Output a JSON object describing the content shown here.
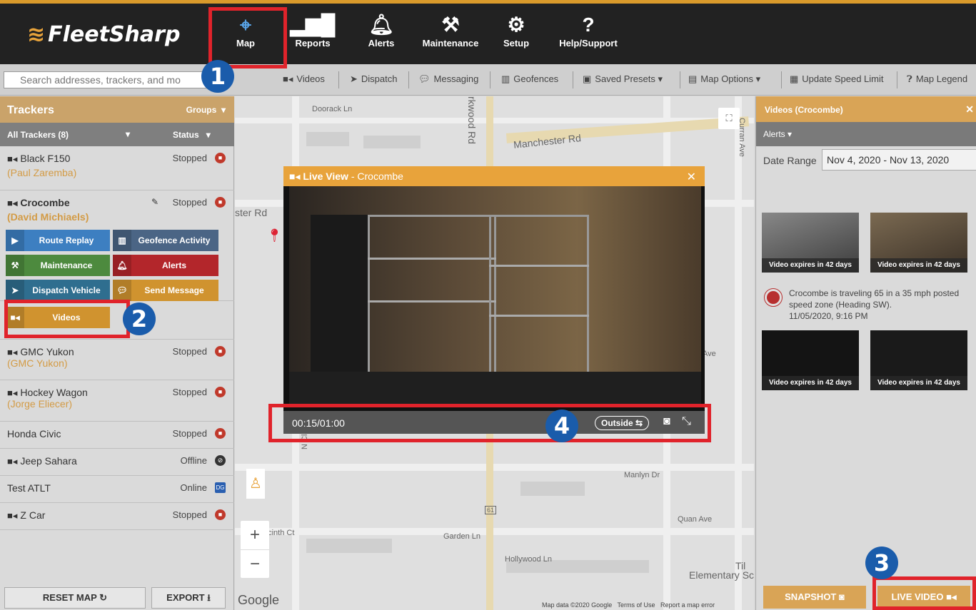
{
  "app": {
    "logo": "FleetSharp"
  },
  "nav": [
    {
      "label": "Map",
      "icon": "map-pin-icon"
    },
    {
      "label": "Reports",
      "icon": "bar-chart-icon"
    },
    {
      "label": "Alerts",
      "icon": "bell-icon"
    },
    {
      "label": "Maintenance",
      "icon": "wrench-car-icon"
    },
    {
      "label": "Setup",
      "icon": "gear-icon"
    },
    {
      "label": "Help/Support",
      "icon": "help-icon"
    }
  ],
  "toolbar": {
    "search_placeholder": "Search addresses, trackers, and mo",
    "videos": "Videos",
    "dispatch": "Dispatch",
    "messaging": "Messaging",
    "geofences": "Geofences",
    "saved_presets": "Saved Presets",
    "map_options": "Map Options",
    "update_speed_limit": "Update Speed Limit",
    "map_legend": "Map Legend"
  },
  "sidebar": {
    "title": "Trackers",
    "groups": "Groups",
    "all_trackers": "All Trackers (8)",
    "status": "Status",
    "trackers": [
      {
        "name": "Black F150",
        "driver": "(Paul Zaremba)",
        "status": "Stopped"
      },
      {
        "name": "Crocombe",
        "driver": "(David Michiaels)",
        "status": "Stopped"
      },
      {
        "name": "GMC Yukon",
        "driver": "(GMC Yukon)",
        "status": "Stopped"
      },
      {
        "name": "Hockey Wagon",
        "driver": "(Jorge Eliecer)",
        "status": "Stopped"
      },
      {
        "name": "Honda Civic",
        "driver": "",
        "status": "Stopped"
      },
      {
        "name": "Jeep Sahara",
        "driver": "",
        "status": "Offline"
      },
      {
        "name": "Test ATLT",
        "driver": "",
        "status": "Online"
      },
      {
        "name": "Z Car",
        "driver": "",
        "status": "Stopped"
      }
    ],
    "actions": {
      "route_replay": "Route Replay",
      "geofence_activity": "Geofence Activity",
      "maintenance": "Maintenance",
      "alerts": "Alerts",
      "dispatch_vehicle": "Dispatch Vehicle",
      "send_message": "Send Message",
      "videos": "Videos"
    },
    "reset_map": "RESET MAP",
    "export": "EXPORT",
    "online_badge": "DG"
  },
  "map": {
    "labels": [
      "Doorack Ln",
      "Manchester Rd",
      "rkwood Rd",
      "ster Rd",
      "N Clay Ave",
      "N Clay Ave",
      "Manlyn Dr",
      "Quan Ave",
      "acinth Ct",
      "Garden Ln",
      "Hollywood Ln",
      "Elementary Sc",
      "Curran Ave",
      "Curran Ave",
      "Curran Ave",
      "N Tay",
      "Ave",
      "Til",
      "61"
    ],
    "google": "Google",
    "footer": "Map data ©2020 Google   Terms of Use   Report a map error"
  },
  "live_view": {
    "title_bold": "Live View",
    "title_rest": " - Crocombe",
    "time": "00:15/01:00",
    "camera": "Outside"
  },
  "right_panel": {
    "title": "Videos (Crocombe)",
    "alerts": "Alerts",
    "date_range_label": "Date Range",
    "date_range_value": "Nov 4, 2020 - Nov 13, 2020",
    "expires": "Video expires in 42 days",
    "alert_message": "Crocombe is traveling 65 in a 35 mph posted speed zone (Heading SW).",
    "alert_time": "11/05/2020, 9:16 PM",
    "snapshot": "SNAPSHOT",
    "live_video": "LIVE VIDEO"
  },
  "callouts": [
    "1",
    "2",
    "3",
    "4"
  ],
  "colors": {
    "accent": "#e8a33b",
    "highlight": "#e0232b",
    "callout": "#1a5cab",
    "stopped": "#c0392b"
  }
}
